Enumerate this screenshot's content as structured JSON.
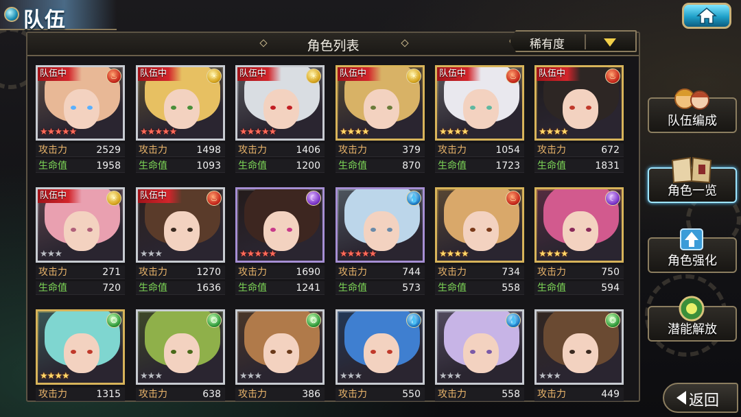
{
  "header": {
    "tab_label": "队伍"
  },
  "panel": {
    "title": "角色列表",
    "sort": {
      "label": "稀有度"
    }
  },
  "card_labels": {
    "team": "队伍中",
    "atk": "攻击力",
    "hp": "生命值"
  },
  "cards": [
    {
      "team": true,
      "element": "fire",
      "frame": "silver",
      "stars": 5,
      "star_color": "red",
      "atk": "2529",
      "hp": "1958",
      "hair": "#e8b896",
      "eye": "#5ab0ff"
    },
    {
      "team": true,
      "element": "light",
      "frame": "silver",
      "stars": 5,
      "star_color": "red",
      "atk": "1498",
      "hp": "1093",
      "hair": "#e7c062",
      "eye": "#4a8f3a"
    },
    {
      "team": true,
      "element": "light",
      "frame": "silver",
      "stars": 5,
      "star_color": "red",
      "atk": "1406",
      "hp": "1200",
      "hair": "#d9dde2",
      "eye": "#c21f24"
    },
    {
      "team": true,
      "element": "light",
      "frame": "gold",
      "stars": 4,
      "star_color": "gold",
      "atk": "379",
      "hp": "870",
      "hair": "#d8b266",
      "eye": "#6b7c3a"
    },
    {
      "team": true,
      "element": "fire",
      "frame": "gold",
      "stars": 4,
      "star_color": "gold",
      "atk": "1054",
      "hp": "1723",
      "hair": "#e9e8ee",
      "eye": "#5fb8a0"
    },
    {
      "team": true,
      "element": "fire",
      "frame": "gold",
      "stars": 4,
      "star_color": "gold",
      "atk": "672",
      "hp": "1831",
      "hair": "#2d2624",
      "eye": "#c0392b"
    },
    {
      "team": true,
      "element": "light",
      "frame": "silver",
      "stars": 3,
      "star_color": "off",
      "atk": "271",
      "hp": "720",
      "hair": "#e9a0b0",
      "eye": "#b0607a"
    },
    {
      "team": true,
      "element": "fire",
      "frame": "silver",
      "stars": 3,
      "star_color": "off",
      "atk": "1270",
      "hp": "1636",
      "hair": "#5a3b2a",
      "eye": "#3a2a20"
    },
    {
      "team": false,
      "element": "dark",
      "frame": "violet",
      "stars": 5,
      "star_color": "red",
      "atk": "1690",
      "hp": "1241",
      "hair": "#3d2620",
      "eye": "#c83a8a"
    },
    {
      "team": false,
      "element": "water",
      "frame": "violet",
      "stars": 5,
      "star_color": "red",
      "atk": "744",
      "hp": "573",
      "hair": "#bcd6ea",
      "eye": "#6a8aa8"
    },
    {
      "team": false,
      "element": "fire",
      "frame": "gold",
      "stars": 4,
      "star_color": "gold",
      "atk": "734",
      "hp": "558",
      "hair": "#d9a86a",
      "eye": "#7a3a1a"
    },
    {
      "team": false,
      "element": "dark",
      "frame": "gold",
      "stars": 4,
      "star_color": "gold",
      "atk": "750",
      "hp": "594",
      "hair": "#d25a8e",
      "eye": "#8a2a5a"
    },
    {
      "team": false,
      "element": "wind",
      "frame": "gold",
      "stars": 4,
      "star_color": "gold",
      "atk": "1315",
      "hp": "",
      "hair": "#7fd6d0",
      "eye": "#c0392b"
    },
    {
      "team": false,
      "element": "wind",
      "frame": "silver",
      "stars": 3,
      "star_color": "off",
      "atk": "638",
      "hp": "",
      "hair": "#8fb04a",
      "eye": "#4a6a1a"
    },
    {
      "team": false,
      "element": "wind",
      "frame": "silver",
      "stars": 3,
      "star_color": "off",
      "atk": "386",
      "hp": "",
      "hair": "#b07a4a",
      "eye": "#6a3a1a"
    },
    {
      "team": false,
      "element": "water",
      "frame": "silver",
      "stars": 3,
      "star_color": "off",
      "atk": "550",
      "hp": "",
      "hair": "#3f7fd0",
      "eye": "#c0392b"
    },
    {
      "team": false,
      "element": "water",
      "frame": "silver",
      "stars": 3,
      "star_color": "off",
      "atk": "558",
      "hp": "",
      "hair": "#c7b4e6",
      "eye": "#7a5aa8"
    },
    {
      "team": false,
      "element": "wind",
      "frame": "silver",
      "stars": 3,
      "star_color": "off",
      "atk": "449",
      "hp": "",
      "hair": "#6a4a32",
      "eye": "#3a2a20"
    }
  ],
  "side_menu": [
    {
      "label": "队伍编成",
      "icon": "party-icon",
      "active": false
    },
    {
      "label": "角色一览",
      "icon": "book-icon",
      "active": true
    },
    {
      "label": "角色强化",
      "icon": "upgrade-icon",
      "active": false
    },
    {
      "label": "潜能解放",
      "icon": "potential-icon",
      "active": false
    }
  ],
  "back_button": {
    "label": "返回"
  },
  "colors": {
    "frame_gold": "#d8b45a",
    "frame_silver": "#bfc3c8",
    "team_red": "#d2252b",
    "atk_label": "#e9b46a",
    "hp_label": "#7ed957",
    "accent_cyan": "#1e9fc8"
  }
}
